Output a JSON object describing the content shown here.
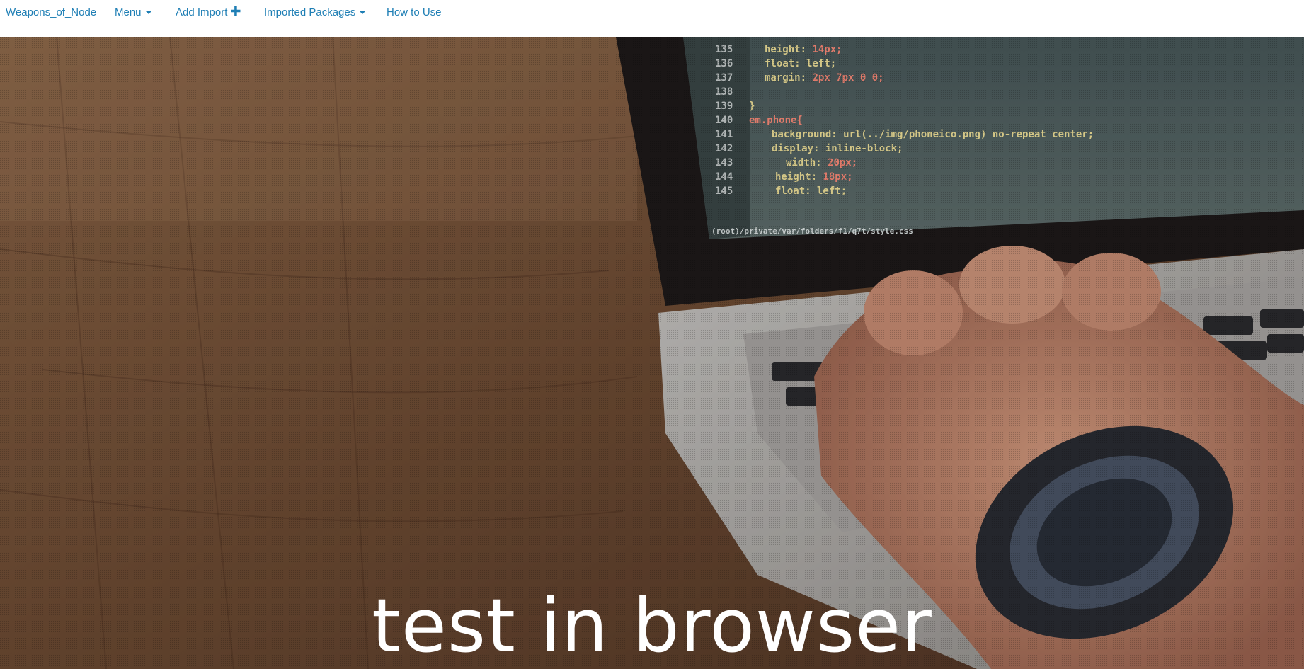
{
  "navbar": {
    "brand": "Weapons_of_Node",
    "menu_label": "Menu",
    "add_import_label": "Add Import",
    "add_import_icon": "plus-icon",
    "imported_packages_label": "Imported Packages",
    "how_to_use_label": "How to Use",
    "link_color": "#1f7fb5"
  },
  "hero": {
    "title": "test in browser",
    "background_image": "laptop-code-photo"
  }
}
